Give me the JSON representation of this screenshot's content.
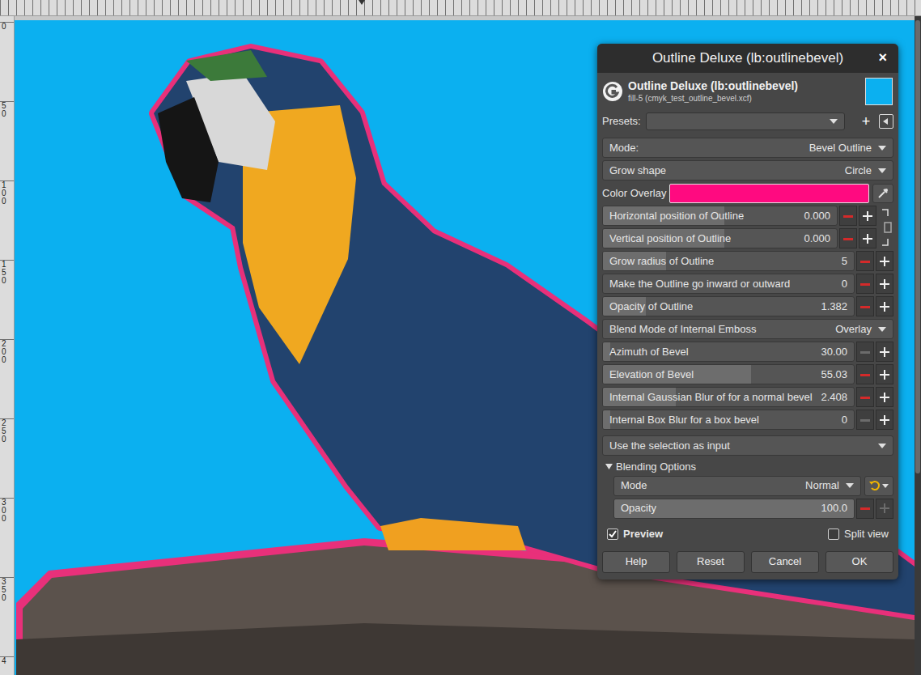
{
  "ruler": {
    "numbers": [
      "0",
      "50",
      "100",
      "150",
      "200",
      "250",
      "300",
      "350",
      "4"
    ]
  },
  "dialog": {
    "title": "Outline Deluxe (lb:outlinebevel)",
    "close": "×",
    "header": {
      "name": "Outline Deluxe (lb:outlinebevel)",
      "subtitle": "fill-5 (cmyk_test_outline_bevel.xcf)",
      "color": "#0bb0f0"
    },
    "presets": {
      "label": "Presets:",
      "value": "",
      "add": "+"
    },
    "rows": [
      {
        "kind": "combo",
        "label": "Mode:",
        "value": "Bevel Outline"
      },
      {
        "kind": "combo",
        "label": "Grow shape",
        "value": "Circle"
      },
      {
        "kind": "color",
        "label": "Color Overlay",
        "color": "#ff0a80"
      },
      {
        "kind": "pair",
        "linked": false,
        "sliders": [
          {
            "label": "Horizontal position of Outline",
            "value": "0.000",
            "level": 0.52,
            "minus_disabled": false,
            "plus_disabled": false
          },
          {
            "label": "Vertical position of Outline",
            "value": "0.000",
            "level": 0.52,
            "minus_disabled": false,
            "plus_disabled": false
          }
        ]
      },
      {
        "kind": "slider",
        "label": "Grow radius of Outline",
        "value": "5",
        "level": 0.25,
        "minus_disabled": false,
        "plus_disabled": false
      },
      {
        "kind": "slider",
        "label": "Make the Outline go inward or outward",
        "value": "0",
        "level": 0,
        "minus_disabled": false,
        "plus_disabled": false
      },
      {
        "kind": "slider",
        "label": "Opacity of Outline",
        "value": "1.382",
        "level": 0.17,
        "minus_disabled": false,
        "plus_disabled": false
      },
      {
        "kind": "combo",
        "label": "Blend Mode of Internal Emboss",
        "value": "Overlay"
      },
      {
        "kind": "slider",
        "label": "Azimuth of Bevel",
        "value": "30.00",
        "level": 0.03,
        "minus_disabled": true,
        "plus_disabled": false
      },
      {
        "kind": "slider",
        "label": "Elevation of Bevel",
        "value": "55.03",
        "level": 0.59,
        "minus_disabled": false,
        "plus_disabled": false
      },
      {
        "kind": "slider",
        "label": "Internal Gaussian Blur of for a normal bevel",
        "value": "2.408",
        "level": 0.29,
        "minus_disabled": false,
        "plus_disabled": false
      },
      {
        "kind": "slider",
        "label": "Internal Box Blur for a box bevel",
        "value": "0",
        "level": 0.03,
        "minus_disabled": true,
        "plus_disabled": false
      }
    ],
    "selection_input": {
      "label": "Use the selection as input",
      "value": ""
    },
    "blending": {
      "label": "Blending Options",
      "expanded": true,
      "mode": {
        "label": "Mode",
        "value": "Normal"
      },
      "opacity": {
        "label": "Opacity",
        "value": "100.0",
        "level": 1,
        "minus_disabled": false,
        "plus_disabled": true
      }
    },
    "preview": {
      "label": "Preview",
      "checked": true
    },
    "split_view": {
      "label": "Split view",
      "checked": false
    },
    "buttons": [
      "Help",
      "Reset",
      "Cancel",
      "OK"
    ]
  }
}
